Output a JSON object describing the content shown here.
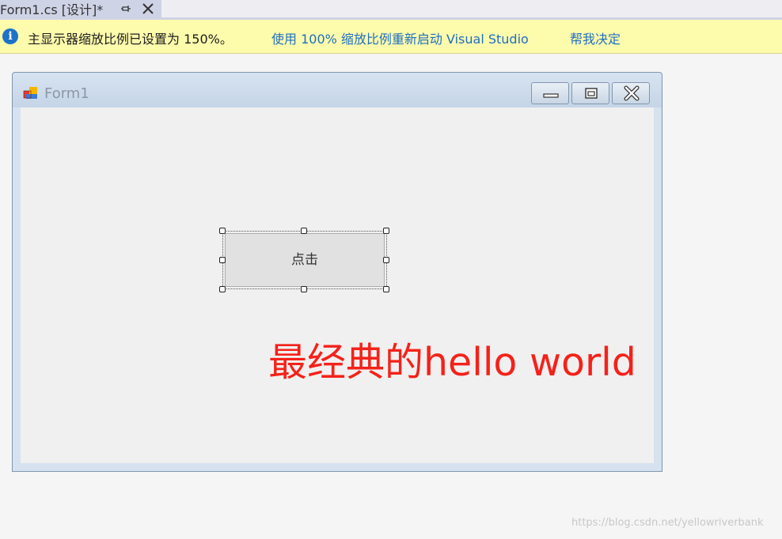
{
  "tab": {
    "title": "Form1.cs [设计]*",
    "pin_symbol": "⊣",
    "close_symbol": "✕"
  },
  "infobar": {
    "message": "主显示器缩放比例已设置为 150%。",
    "link_restart": "使用 100% 缩放比例重新启动 Visual Studio",
    "link_help": "帮我决定",
    "info_symbol": "i"
  },
  "form": {
    "title": "Form1",
    "button_label": "点击",
    "label_text": "最经典的hello world",
    "label_color": "#f4221a"
  },
  "watermark": "https://blog.csdn.net/yellowriverbank",
  "colors": {
    "link": "#1e6fc4",
    "infobar_bg": "#fdfbac",
    "tab_active": "#cfd3e6"
  }
}
